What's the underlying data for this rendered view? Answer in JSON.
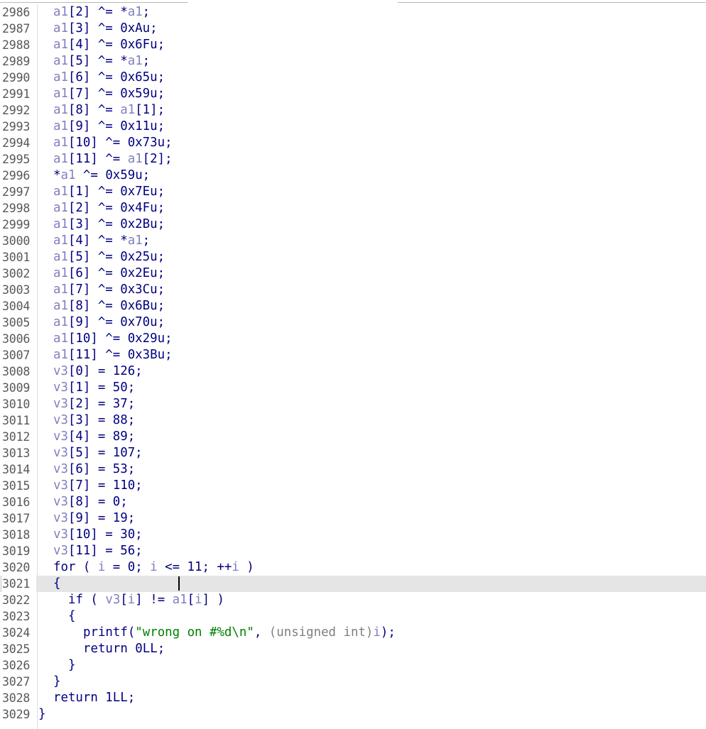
{
  "editor": {
    "lines": [
      {
        "n": "2986",
        "indent": 2,
        "tokens": [
          {
            "t": "a1",
            "c": "var"
          },
          {
            "t": "[2] ^= *"
          },
          {
            "t": "a1",
            "c": "var"
          },
          {
            "t": ";"
          }
        ]
      },
      {
        "n": "2987",
        "indent": 2,
        "tokens": [
          {
            "t": "a1",
            "c": "var"
          },
          {
            "t": "[3] ^= 0xAu;"
          }
        ]
      },
      {
        "n": "2988",
        "indent": 2,
        "tokens": [
          {
            "t": "a1",
            "c": "var"
          },
          {
            "t": "[4] ^= 0x6Fu;"
          }
        ]
      },
      {
        "n": "2989",
        "indent": 2,
        "tokens": [
          {
            "t": "a1",
            "c": "var"
          },
          {
            "t": "[5] ^= *"
          },
          {
            "t": "a1",
            "c": "var"
          },
          {
            "t": ";"
          }
        ]
      },
      {
        "n": "2990",
        "indent": 2,
        "tokens": [
          {
            "t": "a1",
            "c": "var"
          },
          {
            "t": "[6] ^= 0x65u;"
          }
        ]
      },
      {
        "n": "2991",
        "indent": 2,
        "tokens": [
          {
            "t": "a1",
            "c": "var"
          },
          {
            "t": "[7] ^= 0x59u;"
          }
        ]
      },
      {
        "n": "2992",
        "indent": 2,
        "tokens": [
          {
            "t": "a1",
            "c": "var"
          },
          {
            "t": "[8] ^= "
          },
          {
            "t": "a1",
            "c": "var"
          },
          {
            "t": "[1];"
          }
        ]
      },
      {
        "n": "2993",
        "indent": 2,
        "tokens": [
          {
            "t": "a1",
            "c": "var"
          },
          {
            "t": "[9] ^= 0x11u;"
          }
        ]
      },
      {
        "n": "2994",
        "indent": 2,
        "tokens": [
          {
            "t": "a1",
            "c": "var"
          },
          {
            "t": "[10] ^= 0x73u;"
          }
        ]
      },
      {
        "n": "2995",
        "indent": 2,
        "tokens": [
          {
            "t": "a1",
            "c": "var"
          },
          {
            "t": "[11] ^= "
          },
          {
            "t": "a1",
            "c": "var"
          },
          {
            "t": "[2];"
          }
        ]
      },
      {
        "n": "2996",
        "indent": 2,
        "tokens": [
          {
            "t": "*"
          },
          {
            "t": "a1",
            "c": "var"
          },
          {
            "t": " ^= 0x59u;"
          }
        ]
      },
      {
        "n": "2997",
        "indent": 2,
        "tokens": [
          {
            "t": "a1",
            "c": "var"
          },
          {
            "t": "[1] ^= 0x7Eu;"
          }
        ]
      },
      {
        "n": "2998",
        "indent": 2,
        "tokens": [
          {
            "t": "a1",
            "c": "var"
          },
          {
            "t": "[2] ^= 0x4Fu;"
          }
        ]
      },
      {
        "n": "2999",
        "indent": 2,
        "tokens": [
          {
            "t": "a1",
            "c": "var"
          },
          {
            "t": "[3] ^= 0x2Bu;"
          }
        ]
      },
      {
        "n": "3000",
        "indent": 2,
        "tokens": [
          {
            "t": "a1",
            "c": "var"
          },
          {
            "t": "[4] ^= *"
          },
          {
            "t": "a1",
            "c": "var"
          },
          {
            "t": ";"
          }
        ]
      },
      {
        "n": "3001",
        "indent": 2,
        "tokens": [
          {
            "t": "a1",
            "c": "var"
          },
          {
            "t": "[5] ^= 0x25u;"
          }
        ]
      },
      {
        "n": "3002",
        "indent": 2,
        "tokens": [
          {
            "t": "a1",
            "c": "var"
          },
          {
            "t": "[6] ^= 0x2Eu;"
          }
        ]
      },
      {
        "n": "3003",
        "indent": 2,
        "tokens": [
          {
            "t": "a1",
            "c": "var"
          },
          {
            "t": "[7] ^= 0x3Cu;"
          }
        ]
      },
      {
        "n": "3004",
        "indent": 2,
        "tokens": [
          {
            "t": "a1",
            "c": "var"
          },
          {
            "t": "[8] ^= 0x6Bu;"
          }
        ]
      },
      {
        "n": "3005",
        "indent": 2,
        "tokens": [
          {
            "t": "a1",
            "c": "var"
          },
          {
            "t": "[9] ^= 0x70u;"
          }
        ]
      },
      {
        "n": "3006",
        "indent": 2,
        "tokens": [
          {
            "t": "a1",
            "c": "var"
          },
          {
            "t": "[10] ^= 0x29u;"
          }
        ]
      },
      {
        "n": "3007",
        "indent": 2,
        "tokens": [
          {
            "t": "a1",
            "c": "var"
          },
          {
            "t": "[11] ^= 0x3Bu;"
          }
        ]
      },
      {
        "n": "3008",
        "indent": 2,
        "tokens": [
          {
            "t": "v3",
            "c": "var"
          },
          {
            "t": "[0] = 126;"
          }
        ]
      },
      {
        "n": "3009",
        "indent": 2,
        "tokens": [
          {
            "t": "v3",
            "c": "var"
          },
          {
            "t": "[1] = 50;"
          }
        ]
      },
      {
        "n": "3010",
        "indent": 2,
        "tokens": [
          {
            "t": "v3",
            "c": "var"
          },
          {
            "t": "[2] = 37;"
          }
        ]
      },
      {
        "n": "3011",
        "indent": 2,
        "tokens": [
          {
            "t": "v3",
            "c": "var"
          },
          {
            "t": "[3] = 88;"
          }
        ]
      },
      {
        "n": "3012",
        "indent": 2,
        "tokens": [
          {
            "t": "v3",
            "c": "var"
          },
          {
            "t": "[4] = 89;"
          }
        ]
      },
      {
        "n": "3013",
        "indent": 2,
        "tokens": [
          {
            "t": "v3",
            "c": "var"
          },
          {
            "t": "[5] = 107;"
          }
        ]
      },
      {
        "n": "3014",
        "indent": 2,
        "tokens": [
          {
            "t": "v3",
            "c": "var"
          },
          {
            "t": "[6] = 53;"
          }
        ]
      },
      {
        "n": "3015",
        "indent": 2,
        "tokens": [
          {
            "t": "v3",
            "c": "var"
          },
          {
            "t": "[7] = 110;"
          }
        ]
      },
      {
        "n": "3016",
        "indent": 2,
        "tokens": [
          {
            "t": "v3",
            "c": "var"
          },
          {
            "t": "[8] = 0;"
          }
        ]
      },
      {
        "n": "3017",
        "indent": 2,
        "tokens": [
          {
            "t": "v3",
            "c": "var"
          },
          {
            "t": "[9] = 19;"
          }
        ]
      },
      {
        "n": "3018",
        "indent": 2,
        "tokens": [
          {
            "t": "v3",
            "c": "var"
          },
          {
            "t": "[10] = 30;"
          }
        ]
      },
      {
        "n": "3019",
        "indent": 2,
        "tokens": [
          {
            "t": "v3",
            "c": "var"
          },
          {
            "t": "[11] = 56;"
          }
        ]
      },
      {
        "n": "3020",
        "indent": 2,
        "tokens": [
          {
            "t": "for ( "
          },
          {
            "t": "i",
            "c": "var"
          },
          {
            "t": " = 0; "
          },
          {
            "t": "i",
            "c": "var"
          },
          {
            "t": " <= 11; ++"
          },
          {
            "t": "i",
            "c": "var"
          },
          {
            "t": " )"
          }
        ]
      },
      {
        "n": "3021",
        "indent": 2,
        "current": true,
        "tokens": [
          {
            "t": "{"
          }
        ]
      },
      {
        "n": "3022",
        "indent": 4,
        "tokens": [
          {
            "t": "if ( "
          },
          {
            "t": "v3",
            "c": "var"
          },
          {
            "t": "["
          },
          {
            "t": "i",
            "c": "var"
          },
          {
            "t": "] != "
          },
          {
            "t": "a1",
            "c": "var"
          },
          {
            "t": "["
          },
          {
            "t": "i",
            "c": "var"
          },
          {
            "t": "] )"
          }
        ]
      },
      {
        "n": "3023",
        "indent": 4,
        "tokens": [
          {
            "t": "{"
          }
        ]
      },
      {
        "n": "3024",
        "indent": 6,
        "tokens": [
          {
            "t": "printf("
          },
          {
            "t": "\"wrong on #%d\\n\"",
            "c": "str"
          },
          {
            "t": ", "
          },
          {
            "t": "(unsigned int)",
            "c": "cast"
          },
          {
            "t": "i",
            "c": "var"
          },
          {
            "t": ");"
          }
        ]
      },
      {
        "n": "3025",
        "indent": 6,
        "tokens": [
          {
            "t": "return 0LL;"
          }
        ]
      },
      {
        "n": "3026",
        "indent": 4,
        "tokens": [
          {
            "t": "}"
          }
        ]
      },
      {
        "n": "3027",
        "indent": 2,
        "tokens": [
          {
            "t": "}"
          }
        ]
      },
      {
        "n": "3028",
        "indent": 2,
        "tokens": [
          {
            "t": "return 1LL;"
          }
        ]
      },
      {
        "n": "3029",
        "indent": 0,
        "tokens": [
          {
            "t": "}"
          }
        ]
      }
    ]
  }
}
